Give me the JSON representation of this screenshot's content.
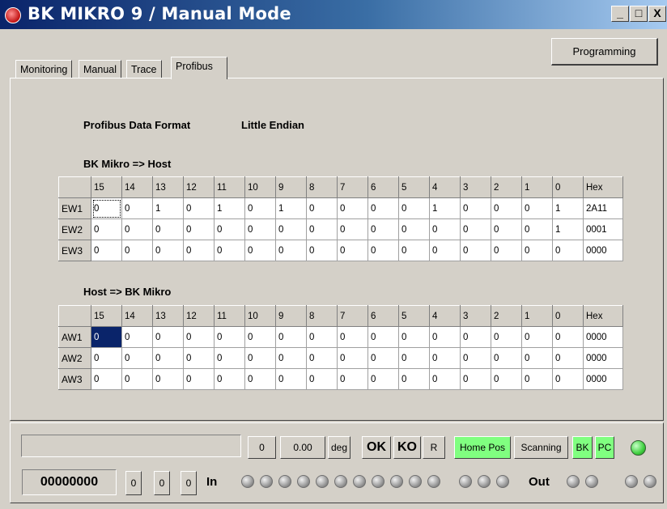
{
  "window": {
    "title": "BK MIKRO 9 / Manual Mode",
    "minimize": "_",
    "maximize": "□",
    "close": "X"
  },
  "programming_button": "Programming",
  "tabs": [
    "Monitoring",
    "Manual",
    "Trace",
    "Profibus"
  ],
  "active_tab": "Profibus",
  "profibus": {
    "format_label": "Profibus Data Format",
    "format_value": "Little Endian"
  },
  "table_in": {
    "title": "BK Mikro => Host",
    "headers": [
      "15",
      "14",
      "13",
      "12",
      "11",
      "10",
      "9",
      "8",
      "7",
      "6",
      "5",
      "4",
      "3",
      "2",
      "1",
      "0",
      "Hex"
    ],
    "rows": [
      {
        "name": "EW1",
        "cells": [
          "0",
          "0",
          "1",
          "0",
          "1",
          "0",
          "1",
          "0",
          "0",
          "0",
          "0",
          "1",
          "0",
          "0",
          "0",
          "1",
          "2A11"
        ]
      },
      {
        "name": "EW2",
        "cells": [
          "0",
          "0",
          "0",
          "0",
          "0",
          "0",
          "0",
          "0",
          "0",
          "0",
          "0",
          "0",
          "0",
          "0",
          "0",
          "1",
          "0001"
        ]
      },
      {
        "name": "EW3",
        "cells": [
          "0",
          "0",
          "0",
          "0",
          "0",
          "0",
          "0",
          "0",
          "0",
          "0",
          "0",
          "0",
          "0",
          "0",
          "0",
          "0",
          "0000"
        ]
      }
    ]
  },
  "table_out": {
    "title": "Host => BK Mikro",
    "headers": [
      "15",
      "14",
      "13",
      "12",
      "11",
      "10",
      "9",
      "8",
      "7",
      "6",
      "5",
      "4",
      "3",
      "2",
      "1",
      "0",
      "Hex"
    ],
    "rows": [
      {
        "name": "AW1",
        "cells": [
          "0",
          "0",
          "0",
          "0",
          "0",
          "0",
          "0",
          "0",
          "0",
          "0",
          "0",
          "0",
          "0",
          "0",
          "0",
          "0",
          "0000"
        ]
      },
      {
        "name": "AW2",
        "cells": [
          "0",
          "0",
          "0",
          "0",
          "0",
          "0",
          "0",
          "0",
          "0",
          "0",
          "0",
          "0",
          "0",
          "0",
          "0",
          "0",
          "0000"
        ]
      },
      {
        "name": "AW3",
        "cells": [
          "0",
          "0",
          "0",
          "0",
          "0",
          "0",
          "0",
          "0",
          "0",
          "0",
          "0",
          "0",
          "0",
          "0",
          "0",
          "0",
          "0000"
        ]
      }
    ]
  },
  "status": {
    "message": "",
    "counter": "0",
    "angle": "0.00",
    "angle_unit": "deg",
    "ok": "OK",
    "ko": "KO",
    "r": "R",
    "home_pos": "Home Pos",
    "scanning": "Scanning",
    "bk": "BK",
    "pc": "PC",
    "binary": "00000000",
    "in_values": [
      "0",
      "0",
      "0"
    ],
    "in_label": "In",
    "out_label": "Out",
    "accent_green": "#80ff80"
  }
}
